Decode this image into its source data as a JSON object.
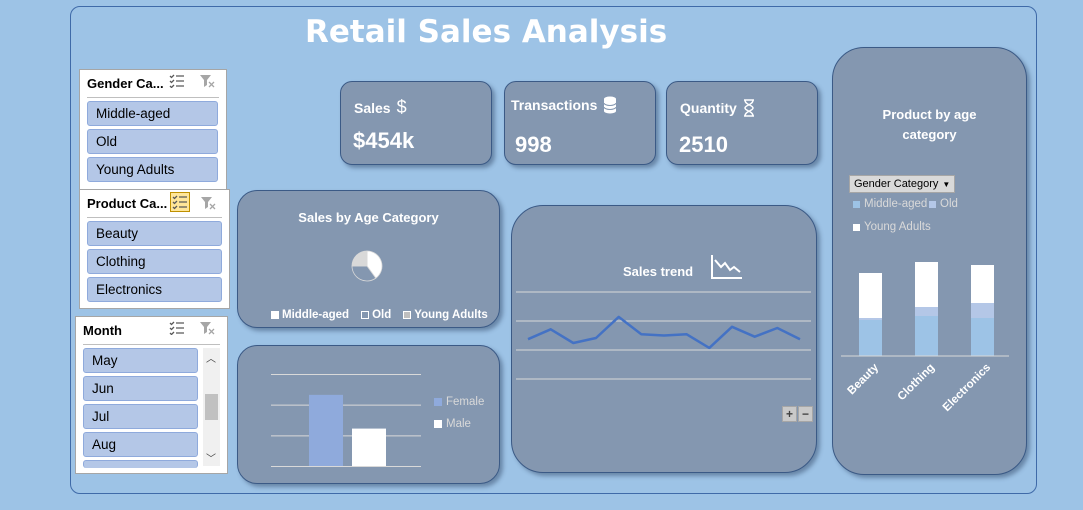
{
  "title": "Retail Sales Analysis",
  "kpis": {
    "sales": {
      "label": "Sales",
      "value": "$454k"
    },
    "transactions": {
      "label": "Transactions",
      "value": "998"
    },
    "quantity": {
      "label": "Quantity",
      "value": "2510"
    }
  },
  "slicers": {
    "gender": {
      "header": "Gender Ca...",
      "items": [
        "Middle-aged",
        "Old",
        "Young Adults"
      ]
    },
    "product": {
      "header": "Product Ca...",
      "items": [
        "Beauty",
        "Clothing",
        "Electronics"
      ]
    },
    "month": {
      "header": "Month",
      "items": [
        "May",
        "Jun",
        "Jul",
        "Aug"
      ]
    }
  },
  "pie_chart": {
    "title": "Sales by Age Category",
    "legend": [
      "Middle-aged",
      "Old",
      "Young Adults"
    ]
  },
  "gender_chart": {
    "legend": [
      "Female",
      "Male"
    ]
  },
  "trend_chart": {
    "title": "Sales trend",
    "zoom_in": "+",
    "zoom_out": "−"
  },
  "age_chart": {
    "title_line1": "Product by age",
    "title_line2": "category",
    "filter_label": "Gender Category",
    "legend": [
      "Middle-aged",
      "Old",
      "Young Adults"
    ]
  },
  "colors": {
    "background": "#9dc3e6",
    "card": "#8497b0",
    "female": "#8faadc",
    "male": "#ffffff",
    "trend_line": "#4472c4"
  },
  "chart_data": [
    {
      "type": "pie",
      "title": "Sales by Age Category",
      "labels": [
        "Middle-aged",
        "Old",
        "Young Adults"
      ],
      "values": [
        0.4,
        0.35,
        0.25
      ]
    },
    {
      "type": "bar",
      "title": "",
      "categories": [
        ""
      ],
      "series": [
        {
          "name": "Female",
          "values": [
            232
          ]
        },
        {
          "name": "Male",
          "values": [
            122
          ]
        }
      ],
      "ylim": [
        0,
        300
      ],
      "grid": true,
      "legend": "right"
    },
    {
      "type": "line",
      "title": "Sales trend",
      "x": [
        1,
        2,
        3,
        4,
        5,
        6,
        7,
        8,
        9,
        10,
        11,
        12,
        13
      ],
      "values": [
        52,
        60,
        49,
        53,
        70,
        56,
        55,
        56,
        45,
        62,
        54,
        61,
        52
      ],
      "ylim": [
        20,
        90
      ],
      "grid": true
    },
    {
      "type": "bar",
      "title": "Product by age category",
      "stacked": true,
      "categories": [
        "Beauty",
        "Clothing",
        "Electronics"
      ],
      "series": [
        {
          "name": "Middle-aged",
          "values": [
            36,
            40,
            38
          ]
        },
        {
          "name": "Old",
          "values": [
            2,
            9,
            15
          ]
        },
        {
          "name": "Young Adults",
          "values": [
            45,
            45,
            38
          ]
        }
      ],
      "ylim": [
        0,
        100
      ],
      "legend": "top-left"
    }
  ]
}
